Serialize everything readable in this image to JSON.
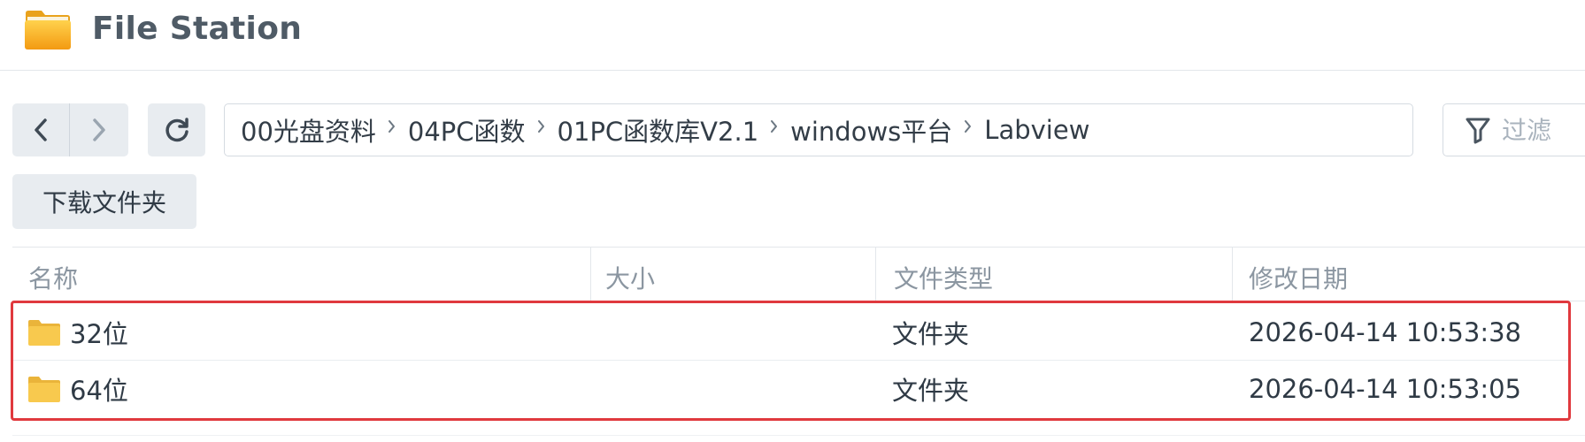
{
  "app": {
    "title": "File Station",
    "icon": "folder-app-icon"
  },
  "toolbar": {
    "back_icon": "chevron-left-icon",
    "forward_icon": "chevron-right-icon",
    "refresh_icon": "refresh-icon",
    "breadcrumbs": [
      "00光盘资料",
      "04PC函数",
      "01PC函数库V2.1",
      "windows平台",
      "Labview"
    ],
    "filter_placeholder": "过滤",
    "filter_icon": "filter-icon",
    "download_label": "下载文件夹"
  },
  "table": {
    "columns": [
      "名称",
      "大小",
      "文件类型",
      "修改日期"
    ],
    "rows": [
      {
        "name": "32位",
        "size": "",
        "type": "文件夹",
        "modified": "2026-04-14 10:53:38",
        "icon": "folder-icon"
      },
      {
        "name": "64位",
        "size": "",
        "type": "文件夹",
        "modified": "2026-04-14 10:53:05",
        "icon": "folder-icon"
      }
    ]
  },
  "colors": {
    "accent_selection": "#e0393e",
    "folder": "#f6c34a",
    "button_bg": "#e8ecf0",
    "header_text": "#8b96a1"
  }
}
